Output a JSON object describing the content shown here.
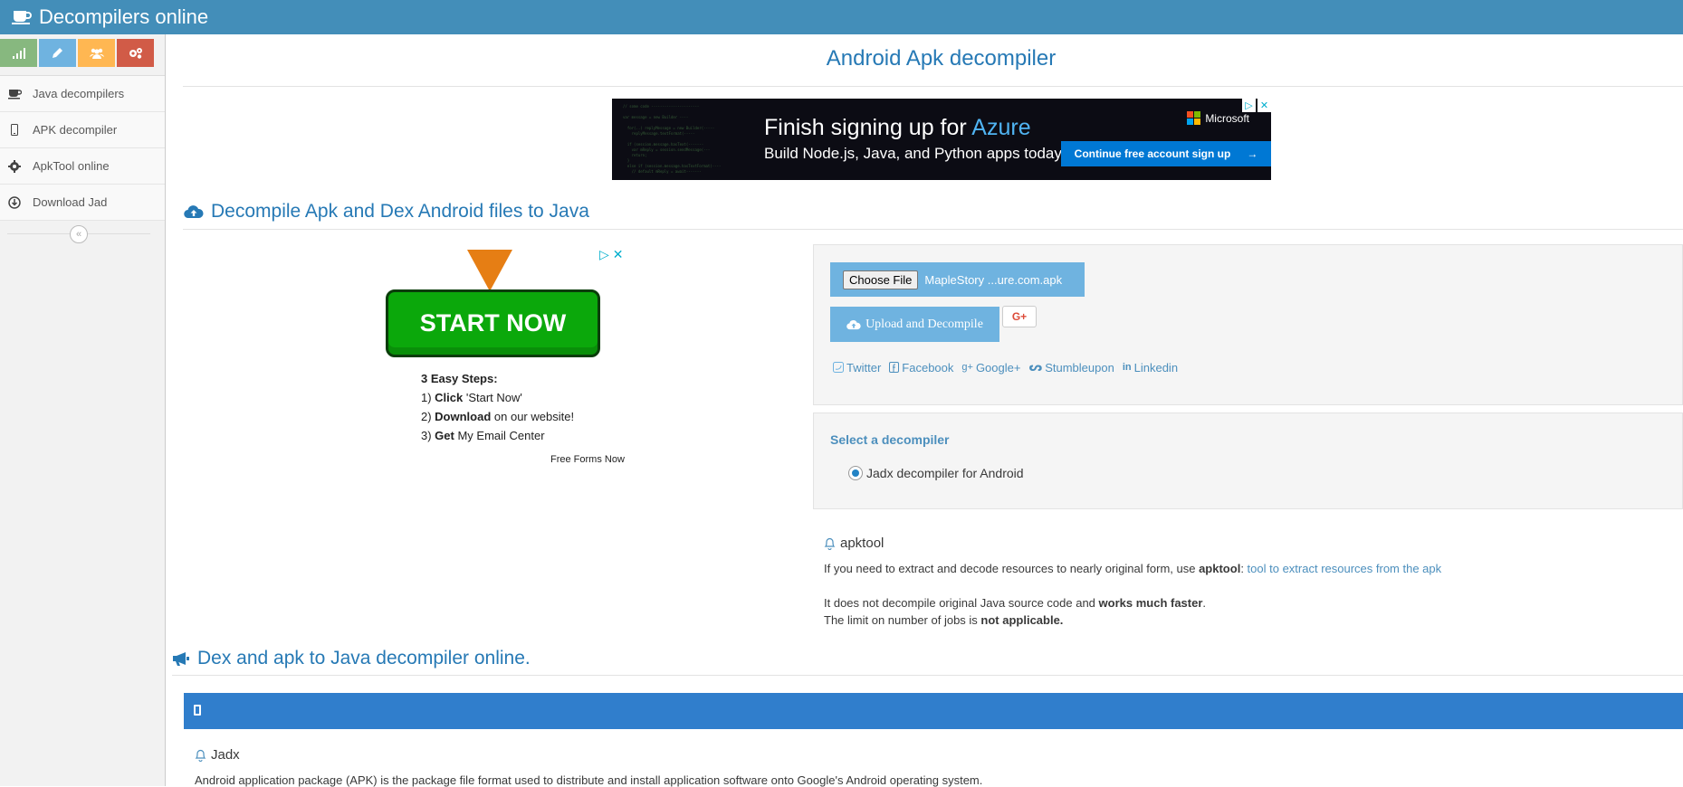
{
  "navbar": {
    "title": "Decompilers online",
    "icon": "coffee-icon"
  },
  "sidebar": {
    "shortcuts": [
      {
        "icon": "signal-icon",
        "color": "#87b87f"
      },
      {
        "icon": "pencil-icon",
        "color": "#6fb3e0"
      },
      {
        "icon": "users-icon",
        "color": "#ffb752"
      },
      {
        "icon": "cogs-icon",
        "color": "#d15b47"
      }
    ],
    "items": [
      {
        "label": "Java decompilers",
        "icon": "coffee-icon"
      },
      {
        "label": "APK decompiler",
        "icon": "mobile-icon"
      },
      {
        "label": "ApkTool online",
        "icon": "gear-icon"
      },
      {
        "label": "Download Jad",
        "icon": "download-icon"
      }
    ],
    "collapse_glyph": "«"
  },
  "main": {
    "page_title": "Android Apk decompiler",
    "top_ad": {
      "headline_prefix": "Finish signing up for ",
      "headline_accent": "Azure",
      "subline": "Build Node.js, Java, and Python apps today.",
      "brand": "Microsoft",
      "cta": "Continue free account sign up",
      "cta_arrow": "→",
      "adchoice_play": "▷",
      "adchoice_close": "✕"
    },
    "section1_title": "Decompile Apk and Dex Android files to Java",
    "side_ad": {
      "button": "START NOW",
      "steps_title": "3 Easy Steps:",
      "step1_num": "1) ",
      "step1_bold": "Click",
      "step1_rest": " 'Start Now'",
      "step2_num": "2) ",
      "step2_bold": "Download",
      "step2_rest": " on our website!",
      "step3_num": "3) ",
      "step3_bold": "Get",
      "step3_rest": " My Email Center",
      "sponsor": "Free Forms Now",
      "adchoice_play": "▷",
      "adchoice_close": "✕"
    },
    "upload": {
      "choose_file": "Choose File",
      "file_name": "MapleStory ...ure.com.apk",
      "upload_button": "Upload and Decompile",
      "gplus": "G+"
    },
    "social": [
      "Twitter",
      "Facebook",
      "Google+",
      "Stumbleupon",
      "Linkedin"
    ],
    "select": {
      "title": "Select a decompiler",
      "option": "Jadx decompiler for Android"
    },
    "apktool": {
      "title": "apktool",
      "line1_prefix": "If you need to extract and decode resources to nearly original form, use ",
      "line1_bold": "apktool",
      "line1_colon": ": ",
      "line1_link": "tool to extract resources from the apk",
      "line2_prefix": "It does not decompile original Java source code and ",
      "line2_bold": "works much faster",
      "line2_suffix": ".",
      "line3_prefix": "The limit on number of jobs is ",
      "line3_bold": "not applicable."
    },
    "section2_title": "Dex and apk to Java decompiler online.",
    "jadx": {
      "title": "Jadx",
      "text": "Android application package (APK) is the package file format used to distribute and install application software onto Google's Android operating system."
    }
  },
  "colors": {
    "navbar": "#438eb9",
    "accent": "#2679b5",
    "button": "#6fb3e0",
    "bar": "#307ecc"
  }
}
